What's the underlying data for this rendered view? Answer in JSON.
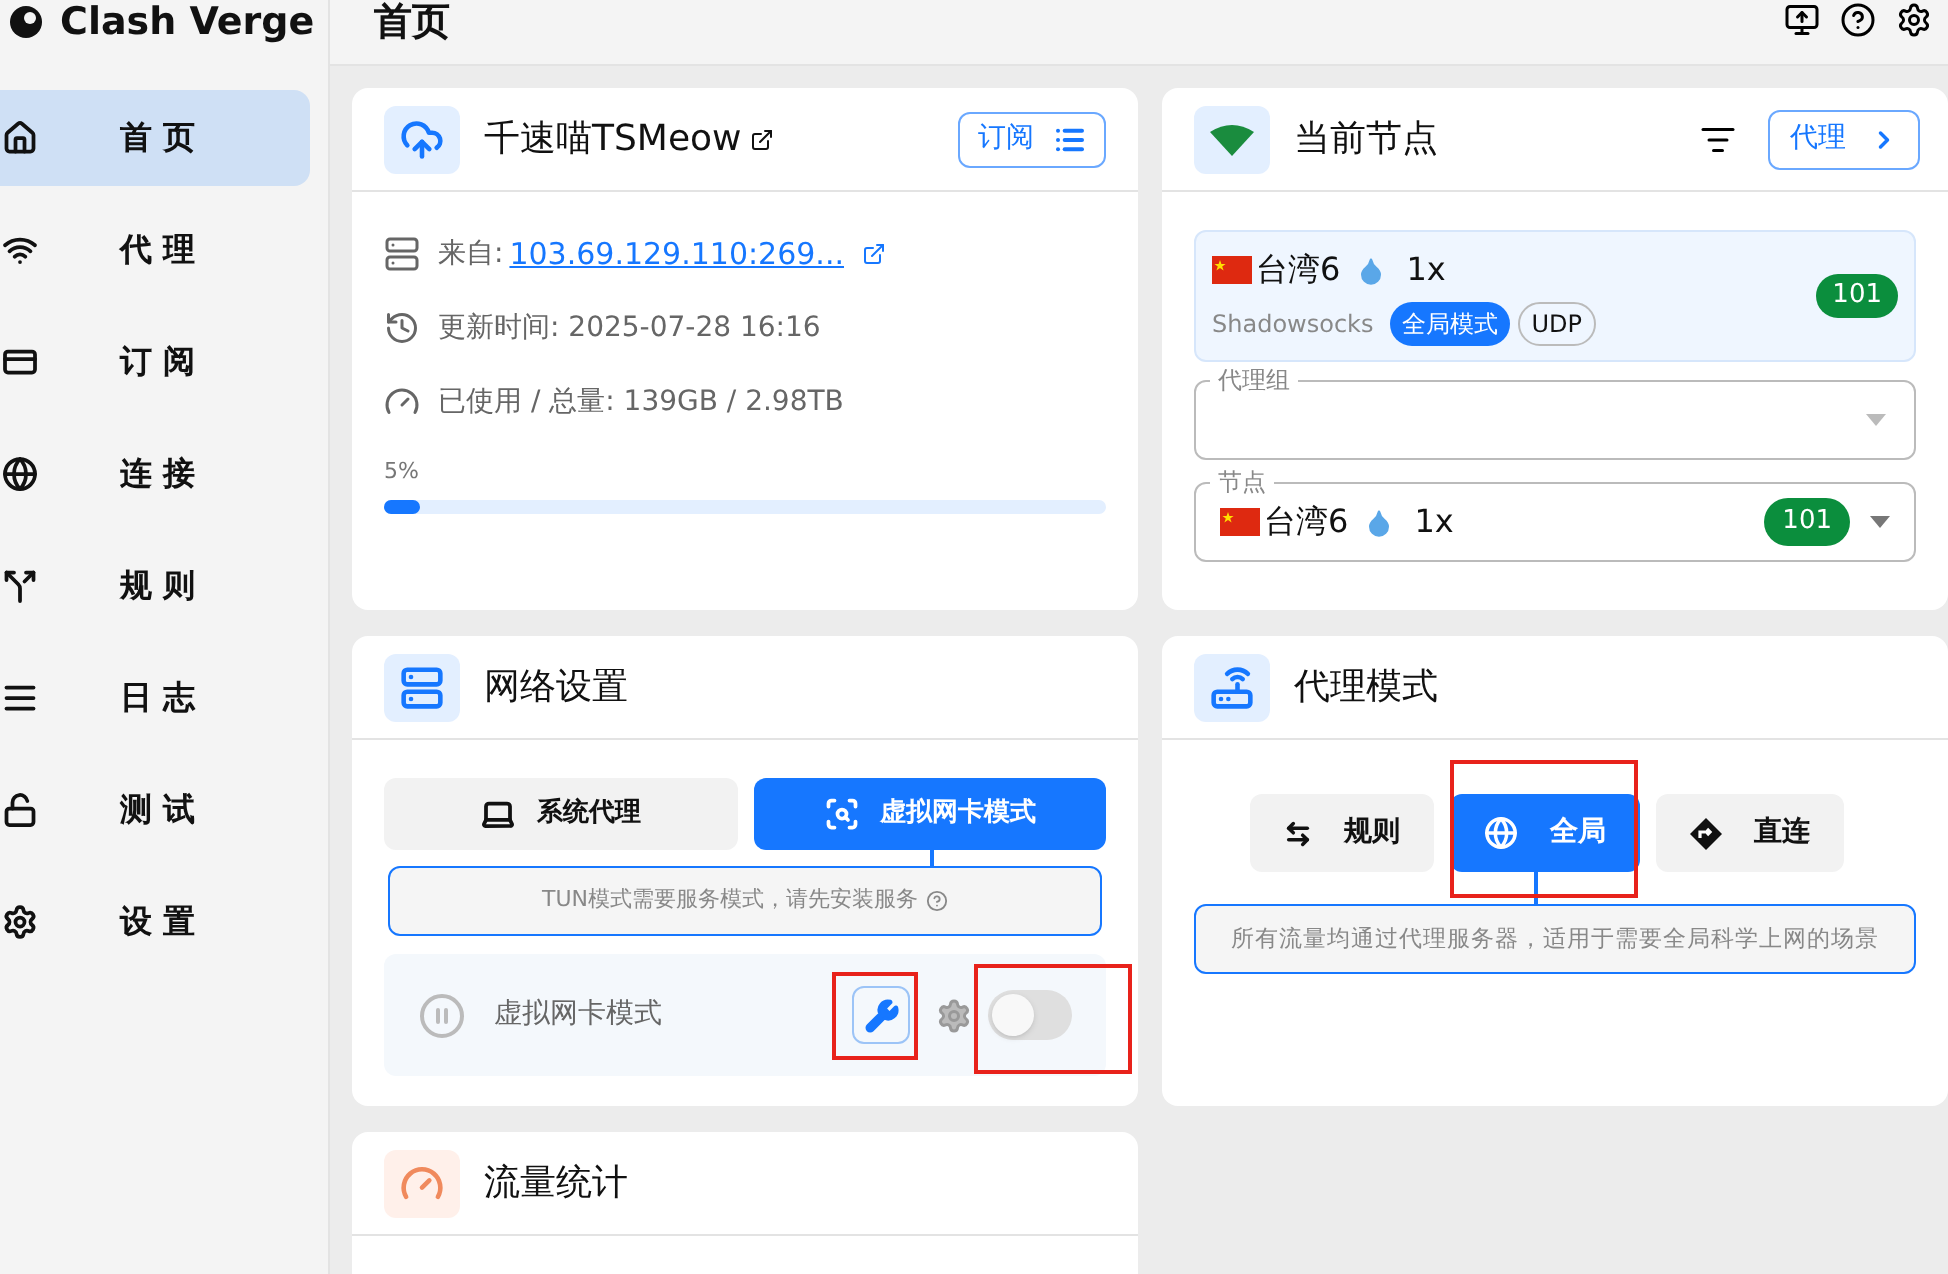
{
  "logo": "Clash Verge",
  "page_title": "首页",
  "sidebar": [
    {
      "label": "首 页",
      "selected": true
    },
    {
      "label": "代 理",
      "selected": false
    },
    {
      "label": "订 阅",
      "selected": false
    },
    {
      "label": "连 接",
      "selected": false
    },
    {
      "label": "规 则",
      "selected": false
    },
    {
      "label": "日 志",
      "selected": false
    },
    {
      "label": "测 试",
      "selected": false
    },
    {
      "label": "设 置",
      "selected": false
    }
  ],
  "subscription": {
    "title": "千速喵TSMeow",
    "button": "订阅",
    "from_label": "来自:",
    "from_link": "103.69.129.110:269...",
    "updated": "更新时间: 2025-07-28 16:16",
    "usage": "已使用 / 总量: 139GB / 2.98TB",
    "percent": "5%",
    "level": 0.05
  },
  "current_node": {
    "title": "当前节点",
    "button": "代理",
    "node_name": "台湾6",
    "multiplier": "1x",
    "protocol": "Shadowsocks",
    "tags": [
      {
        "label": "全局模式",
        "kind": "filled"
      },
      {
        "label": "UDP",
        "kind": "outline"
      }
    ],
    "delay": "101",
    "group_label": "代理组",
    "node_label": "节点",
    "select_node": "台湾6",
    "select_multiplier": "1x",
    "select_delay": "101"
  },
  "network": {
    "title": "网络设置",
    "tabs": [
      {
        "label": "系统代理",
        "selected": false
      },
      {
        "label": "虚拟网卡模式",
        "selected": true
      }
    ],
    "hint": "TUN模式需要服务模式，请先安装服务",
    "row_label": "虚拟网卡模式",
    "on": false
  },
  "proxy_mode": {
    "title": "代理模式",
    "modes": [
      {
        "label": "规则",
        "selected": false
      },
      {
        "label": "全局",
        "selected": true
      },
      {
        "label": "直连",
        "selected": false
      }
    ],
    "description": "所有流量均通过代理服务器，适用于需要全局科学上网的场景"
  },
  "traffic": {
    "title": "流量统计"
  }
}
